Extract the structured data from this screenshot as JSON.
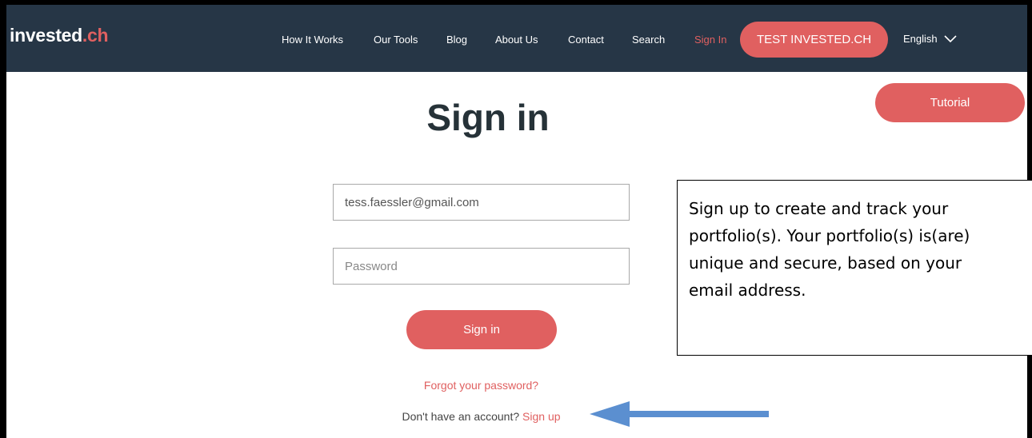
{
  "brand": {
    "name": "invested",
    "suffix": ".ch"
  },
  "nav": {
    "items": [
      {
        "label": "How It Works",
        "active": false
      },
      {
        "label": "Our Tools",
        "active": false
      },
      {
        "label": "Blog",
        "active": false
      },
      {
        "label": "About Us",
        "active": false
      },
      {
        "label": "Contact",
        "active": false
      },
      {
        "label": "Search",
        "active": false
      },
      {
        "label": "Sign In",
        "active": true
      }
    ],
    "cta_label": "TEST INVESTED.CH",
    "language": "English"
  },
  "tutorial_label": "Tutorial",
  "page": {
    "title": "Sign in",
    "email_value": "tess.faessler@gmail.com",
    "password_placeholder": "Password",
    "submit_label": "Sign in",
    "forgot_label": "Forgot your password?",
    "no_account_text": "Don't have an account?",
    "signup_label": "Sign up"
  },
  "callout": {
    "text": "Sign up to create and track your\nportfolio(s). Your portfolio(s) is(are)\nunique and secure, based on your\nemail address."
  },
  "colors": {
    "nav_bg": "#263646",
    "accent": "#e06060",
    "arrow": "#5b8fd0"
  }
}
